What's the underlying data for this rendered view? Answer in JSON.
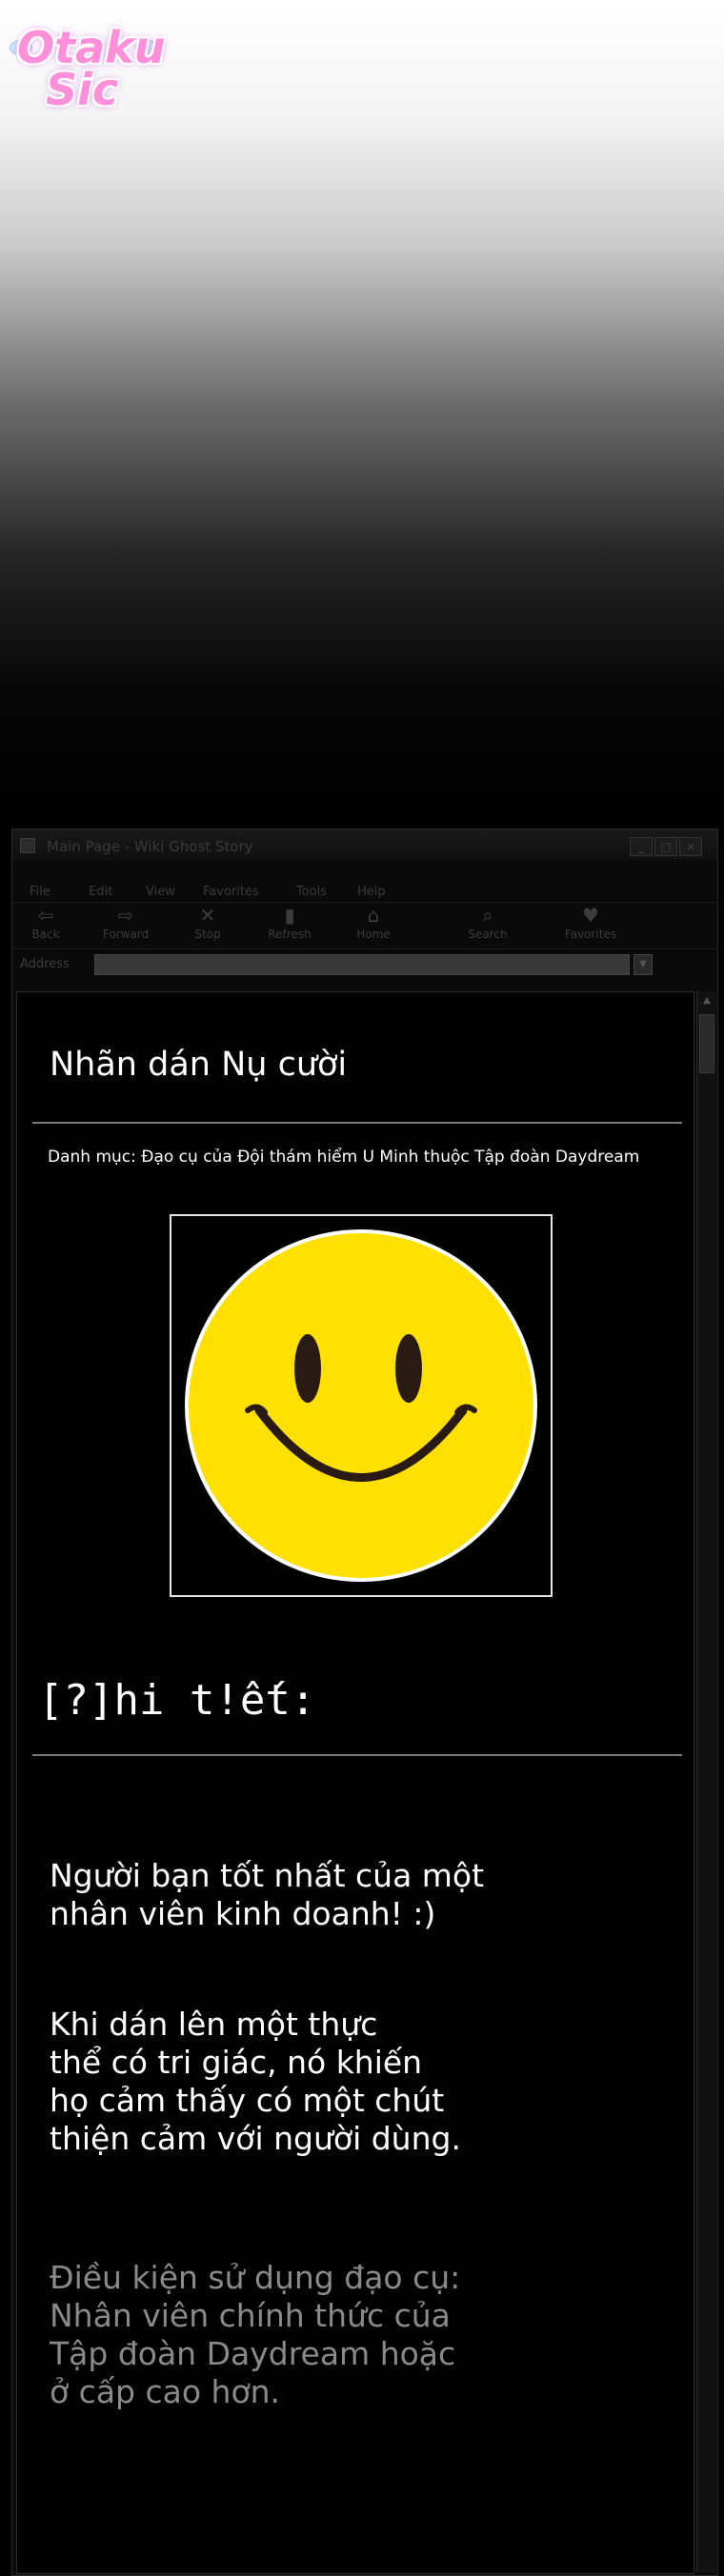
{
  "logo": {
    "line1": "Otaku",
    "line2": "Sic"
  },
  "window": {
    "title": "Main Page - Wiki Ghost Story",
    "controls": {
      "minimize": "_",
      "maximize": "□",
      "close": "×"
    }
  },
  "menu": [
    "File",
    "Edit",
    "View",
    "Favorites",
    "Tools",
    "Help"
  ],
  "toolbar": [
    {
      "label": "Back",
      "icon": "back-arrow-icon",
      "glyph": "⇦"
    },
    {
      "label": "Forward",
      "icon": "forward-arrow-icon",
      "glyph": "⇨"
    },
    {
      "label": "Stop",
      "icon": "stop-icon",
      "glyph": "✕"
    },
    {
      "label": "Refresh",
      "icon": "refresh-icon",
      "glyph": "▮"
    },
    {
      "label": "Home",
      "icon": "home-icon",
      "glyph": "⌂"
    },
    {
      "label": "Search",
      "icon": "search-icon",
      "glyph": "⌕"
    },
    {
      "label": "Favorites",
      "icon": "heart-icon",
      "glyph": "♥"
    }
  ],
  "address": {
    "label": "Address",
    "value": "",
    "dropdown": "▼"
  },
  "article": {
    "title": "Nhãn dán Nụ cười",
    "category": "Danh mục: Đạo cụ của Đội thám hiểm U Minh thuộc Tập đoàn Daydream",
    "details_heading": "[?]hi t!ết:",
    "paragraphs": [
      "Người bạn tốt nhất của một\nnhân viên kinh doanh! :)",
      "Khi dán lên một thực\nthể có tri giác, nó khiến\nhọ cảm thấy có một chút\nthiện cảm với người dùng.",
      "Điều kiện sử dụng đạo cụ:\nNhân viên chính thức của\nTập đoàn Daydream hoặc\nở cấp cao hơn."
    ]
  },
  "colors": {
    "smiley_fill": "#ffe000",
    "smiley_features": "#2a1a14",
    "smiley_outline": "#ffffff"
  }
}
